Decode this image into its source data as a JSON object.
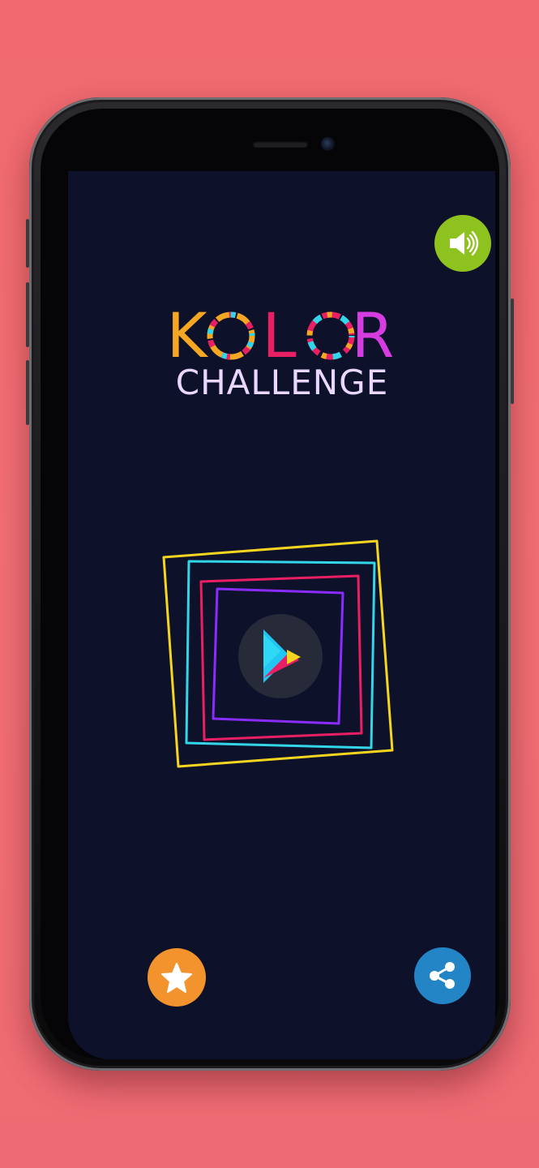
{
  "app": {
    "title_line_1": "KOLOR",
    "title_line_2": "CHALLENGE"
  },
  "buttons": {
    "sound": {
      "icon": "speaker-volume-icon",
      "color": "#8ec21f"
    },
    "play": {
      "icon": "play-triangle-icon",
      "color": "#262a39"
    },
    "rate": {
      "icon": "star-icon",
      "color": "#f2932d"
    },
    "share": {
      "icon": "share-icon",
      "color": "#2384c6"
    }
  },
  "colors": {
    "background": "#f06a6f",
    "screen": "#0e112a",
    "yellow": "#f5d51f",
    "cyan": "#33d6e8",
    "pink": "#e91f63",
    "purple": "#8a2cff",
    "title_line_2": "#ead7ff"
  }
}
